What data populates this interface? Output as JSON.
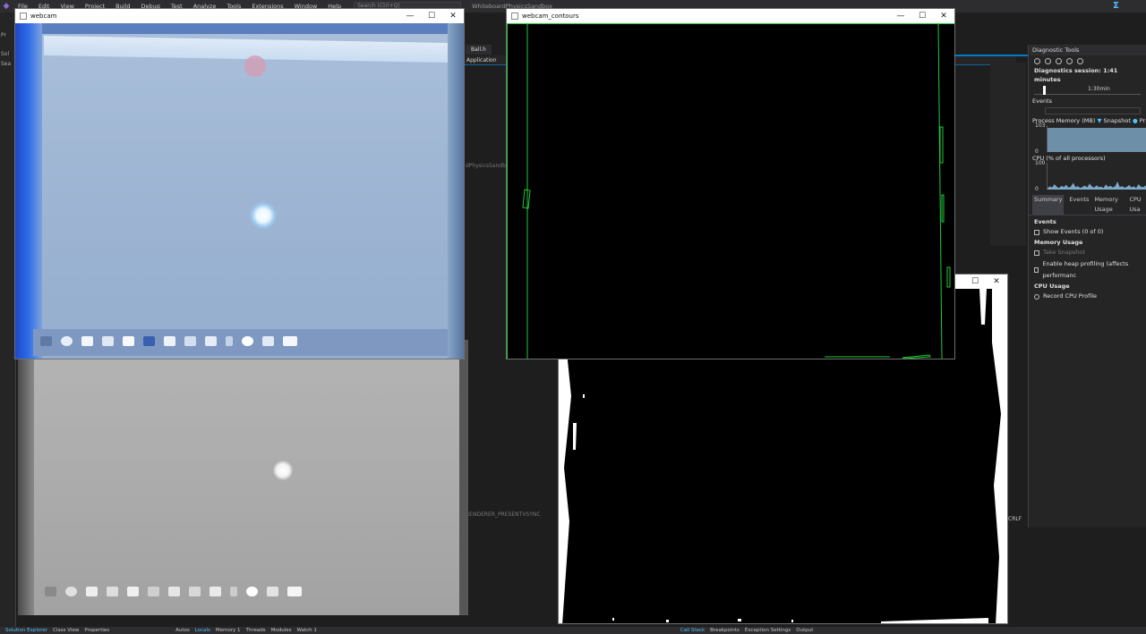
{
  "ide": {
    "menu": [
      "File",
      "Edit",
      "View",
      "Project",
      "Build",
      "Debug",
      "Test",
      "Analyze",
      "Tools",
      "Extensions",
      "Window",
      "Help"
    ],
    "search_placeholder": "Search (Ctrl+Q)",
    "solution_name": "WhiteboardPhysicsSandbox",
    "left_strip": [
      "Pr",
      "Sol",
      "Sea"
    ],
    "editor_tab": "Ball.h",
    "editor_subtab": "Application",
    "code_hint_1": "dPhysicsSandbox",
    "code_hint_2": "RENDERER_PRESENTVSYNC",
    "line_ending": "CRLF"
  },
  "diagnostics": {
    "title": "Diagnostic Tools",
    "session": "Diagnostics session: 1:41 minutes",
    "timeline_label": "1:30min",
    "events_heading": "Events",
    "process_memory": {
      "label": "Process Memory (MB)",
      "snapshot_legend": "Snapshot",
      "private_legend": "Pr",
      "ymax": "103",
      "ymin": "0",
      "fill_fraction": 0.9
    },
    "cpu": {
      "label": "CPU (% of all processors)",
      "ymax": "100",
      "ymin": "0",
      "samples": [
        5,
        12,
        8,
        20,
        10,
        6,
        14,
        9,
        18,
        7,
        11,
        25,
        9,
        13,
        6,
        10,
        15,
        8,
        22,
        12,
        7,
        16,
        9,
        11,
        6,
        19,
        10,
        14,
        8,
        12,
        30,
        9,
        13,
        7,
        10,
        17,
        8,
        12,
        6,
        20,
        11,
        9,
        15,
        8
      ]
    },
    "tabs": [
      "Summary",
      "Events",
      "Memory Usage",
      "CPU Usa"
    ],
    "active_tab": "Summary",
    "summary": {
      "events_head": "Events",
      "show_events": "Show Events (0 of 0)",
      "memory_head": "Memory Usage",
      "take_snapshot": "Take Snapshot",
      "heap_profiling": "Enable heap profiling (affects performanc",
      "cpu_head": "CPU Usage",
      "record_cpu": "Record CPU Profile"
    }
  },
  "bottom_bar": {
    "left": [
      "Solution Explorer",
      "Class View",
      "Properties"
    ],
    "mid": [
      "Autos",
      "Locals",
      "Memory 1",
      "Threads",
      "Modules",
      "Watch 1"
    ],
    "right": [
      "Call Stack",
      "Breakpoints",
      "Exception Settings",
      "Output"
    ]
  },
  "windows": {
    "webcam": {
      "title": "webcam",
      "min": "—",
      "max": "☐",
      "close": "✕"
    },
    "contours": {
      "title": "webcam_contours",
      "min": "—",
      "max": "☐",
      "close": "✕"
    },
    "threshold": {
      "max": "☐",
      "close": "✕"
    }
  },
  "colors": {
    "accent": "#007acc",
    "contour_green": "#22c93a",
    "memory_fill": "#6d8fa8",
    "cpu_fill": "#7aa8c8"
  }
}
